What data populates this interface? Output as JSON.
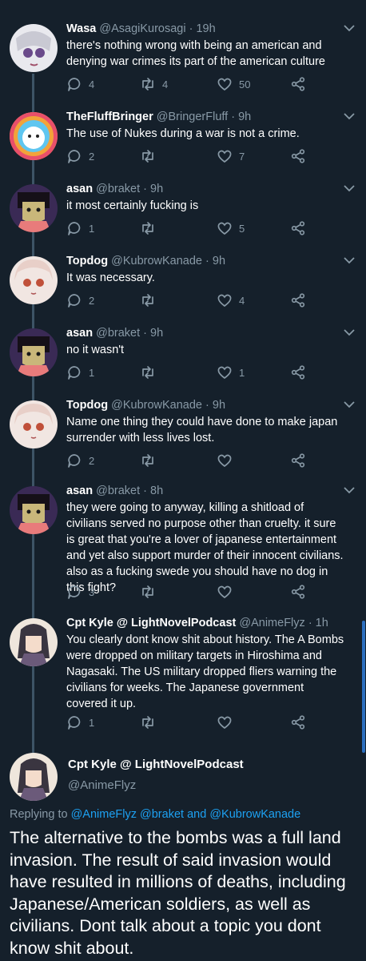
{
  "tweets": [
    {
      "name": "Wasa",
      "handle": "@AsagiKurosagi",
      "time": "· 19h",
      "text": "there's nothing wrong with being an american and denying war crimes its part of the american culture",
      "replies": "4",
      "retweets": "4",
      "likes": "50"
    },
    {
      "name": "TheFluffBringer",
      "handle": "@BringerFluff",
      "time": "· 9h",
      "text": "The use of Nukes during a war is not a crime.",
      "replies": "2",
      "retweets": "",
      "likes": "7"
    },
    {
      "name": "asan",
      "handle": "@braket",
      "time": "· 9h",
      "text": "it most certainly fucking is",
      "replies": "1",
      "retweets": "",
      "likes": "5"
    },
    {
      "name": "Topdog",
      "handle": "@KubrowKanade",
      "time": "· 9h",
      "text": "It was necessary.",
      "replies": "2",
      "retweets": "",
      "likes": "4"
    },
    {
      "name": "asan",
      "handle": "@braket",
      "time": "· 9h",
      "text": "no it wasn't",
      "replies": "1",
      "retweets": "",
      "likes": "1"
    },
    {
      "name": "Topdog",
      "handle": "@KubrowKanade",
      "time": "· 9h",
      "text": "Name one thing they could have done to make japan surrender with less lives lost.",
      "replies": "2",
      "retweets": "",
      "likes": ""
    },
    {
      "name": "asan",
      "handle": "@braket",
      "time": "· 8h",
      "text": "they were going to anyway, killing a shitload of civilians served no purpose other than cruelty. it sure is great that you're a lover of japanese entertainment and yet also support murder of their innocent civilians. also as a fucking swede you should have no dog in this fight?",
      "replies": "3",
      "retweets": "",
      "likes": ""
    },
    {
      "name": "Cpt Kyle @ LightNovelPodcast",
      "handle": "@AnimeFlyz",
      "time": "· 1h",
      "text": "You clearly dont know shit about history.  The A Bombs were dropped on military targets in Hiroshima and Nagasaki.  The US military dropped fliers warning the civilians for weeks.  The Japanese government covered it up.",
      "replies": "1",
      "retweets": "",
      "likes": ""
    }
  ],
  "focused": {
    "name": "Cpt Kyle @ LightNovelPodcast",
    "handle": "@AnimeFlyz",
    "replying_prefix": "Replying to",
    "mention1": "@AnimeFlyz",
    "mention2": "@braket",
    "and": "and",
    "mention3": "@KubrowKanade",
    "text": "The alternative to the bombs was a full land invasion.  The result of said invasion would have resulted in millions of deaths, including Japanese/American soldiers, as well as civilians.  Dont talk about a topic you dont know shit about."
  },
  "icons": [
    "reply-icon",
    "retweet-icon",
    "like-icon",
    "share-icon",
    "caret-down-icon"
  ],
  "colors": {
    "background": "#15202b",
    "muted": "#8899a6",
    "link": "#1da1f2",
    "thread": "#3d5466"
  }
}
